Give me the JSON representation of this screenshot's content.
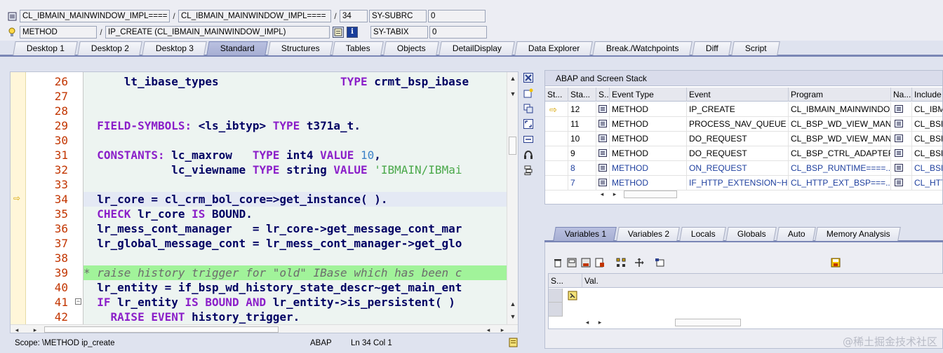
{
  "header": {
    "row1": {
      "program_a": "CL_IBMAIN_MAINWINDOW_IMPL====",
      "program_b": "CL_IBMAIN_MAINWINDOW_IMPL====",
      "line": "34",
      "sysvar_name": "SY-SUBRC",
      "sysvar_value": "0"
    },
    "row2": {
      "type": "METHOD",
      "event": "IP_CREATE (CL_IBMAIN_MAINWINDOW_IMPL)",
      "sysvar_name": "SY-TABIX",
      "sysvar_value": "0",
      "info_label": "i"
    }
  },
  "tabs": [
    {
      "label": "Desktop 1",
      "active": false
    },
    {
      "label": "Desktop 2",
      "active": false
    },
    {
      "label": "Desktop 3",
      "active": false
    },
    {
      "label": "Standard",
      "active": true
    },
    {
      "label": "Structures",
      "active": false
    },
    {
      "label": "Tables",
      "active": false
    },
    {
      "label": "Objects",
      "active": false
    },
    {
      "label": "DetailDisplay",
      "active": false
    },
    {
      "label": "Data Explorer",
      "active": false
    },
    {
      "label": "Break./Watchpoints",
      "active": false
    },
    {
      "label": "Diff",
      "active": false
    },
    {
      "label": "Script",
      "active": false
    }
  ],
  "editor": {
    "line_numbers": [
      "26",
      "27",
      "28",
      "29",
      "30",
      "31",
      "32",
      "33",
      "34",
      "35",
      "36",
      "37",
      "38",
      "39",
      "40",
      "41",
      "42"
    ],
    "current_line": "34",
    "lines": [
      "      lt_ibase_types                  TYPE crmt_bsp_ibase",
      "",
      "",
      "  FIELD-SYMBOLS: <ls_ibtyp> TYPE t371a_t.",
      "",
      "  CONSTANTS: lc_maxrow   TYPE int4 VALUE 10,",
      "             lc_viewname TYPE string VALUE 'IBMAIN/IBMai",
      "",
      "  lr_core = cl_crm_bol_core=>get_instance( ).",
      "  CHECK lr_core IS BOUND.",
      "  lr_mess_cont_manager   = lr_core->get_message_cont_mar",
      "  lr_global_message_cont = lr_mess_cont_manager->get_glo",
      "",
      "* raise history trigger for \"old\" IBase which has been c",
      "  lr_entity = if_bsp_wd_history_state_descr~get_main_ent",
      "  IF lr_entity IS BOUND AND lr_entity->is_persistent( ) ",
      "    RAISE EVENT history_trigger."
    ]
  },
  "status": {
    "scope": "Scope: \\METHOD ip_create",
    "language": "ABAP",
    "position": "Ln  34 Col   1"
  },
  "stack": {
    "title": "ABAP and Screen Stack",
    "columns": [
      "St...",
      "Sta...",
      "S...",
      "Event Type",
      "Event",
      "Program",
      "Na...",
      "Include"
    ],
    "rows": [
      {
        "current": true,
        "level": "12",
        "event_type": "METHOD",
        "event": "IP_CREATE",
        "program": "CL_IBMAIN_MAINWINDO...",
        "include": "CL_IBMA"
      },
      {
        "current": false,
        "level": "11",
        "event_type": "METHOD",
        "event": "PROCESS_NAV_QUEUE",
        "program": "CL_BSP_WD_VIEW_MAN...",
        "include": "CL_BSP_"
      },
      {
        "current": false,
        "level": "10",
        "event_type": "METHOD",
        "event": "DO_REQUEST",
        "program": "CL_BSP_WD_VIEW_MAN...",
        "include": "CL_BSP_"
      },
      {
        "current": false,
        "level": "9",
        "event_type": "METHOD",
        "event": "DO_REQUEST",
        "program": "CL_BSP_CTRL_ADAPTER...",
        "include": "CL_BSP_"
      },
      {
        "current": false,
        "level": "8",
        "event_type": "METHOD",
        "event": "ON_REQUEST",
        "program": "CL_BSP_RUNTIME====...",
        "include": "CL_BSP_"
      },
      {
        "current": false,
        "level": "7",
        "event_type": "METHOD",
        "event": "IF_HTTP_EXTENSION~H...",
        "program": "CL_HTTP_EXT_BSP===...",
        "include": "CL_HTTI"
      }
    ]
  },
  "variables": {
    "tabs": [
      {
        "label": "Variables 1",
        "active": true
      },
      {
        "label": "Variables 2",
        "active": false
      },
      {
        "label": "Locals",
        "active": false
      },
      {
        "label": "Globals",
        "active": false
      },
      {
        "label": "Auto",
        "active": false
      },
      {
        "label": "Memory Analysis",
        "active": false
      }
    ],
    "columns": [
      "S...",
      "Val."
    ]
  },
  "watermark": "@稀土掘金技术社区",
  "colors": {
    "tab_active": "#a7afd3",
    "comment_bg": "#a1f39a",
    "keyword": "#8b1fc9",
    "line_number": "#c23500",
    "code_text": "#000063"
  }
}
